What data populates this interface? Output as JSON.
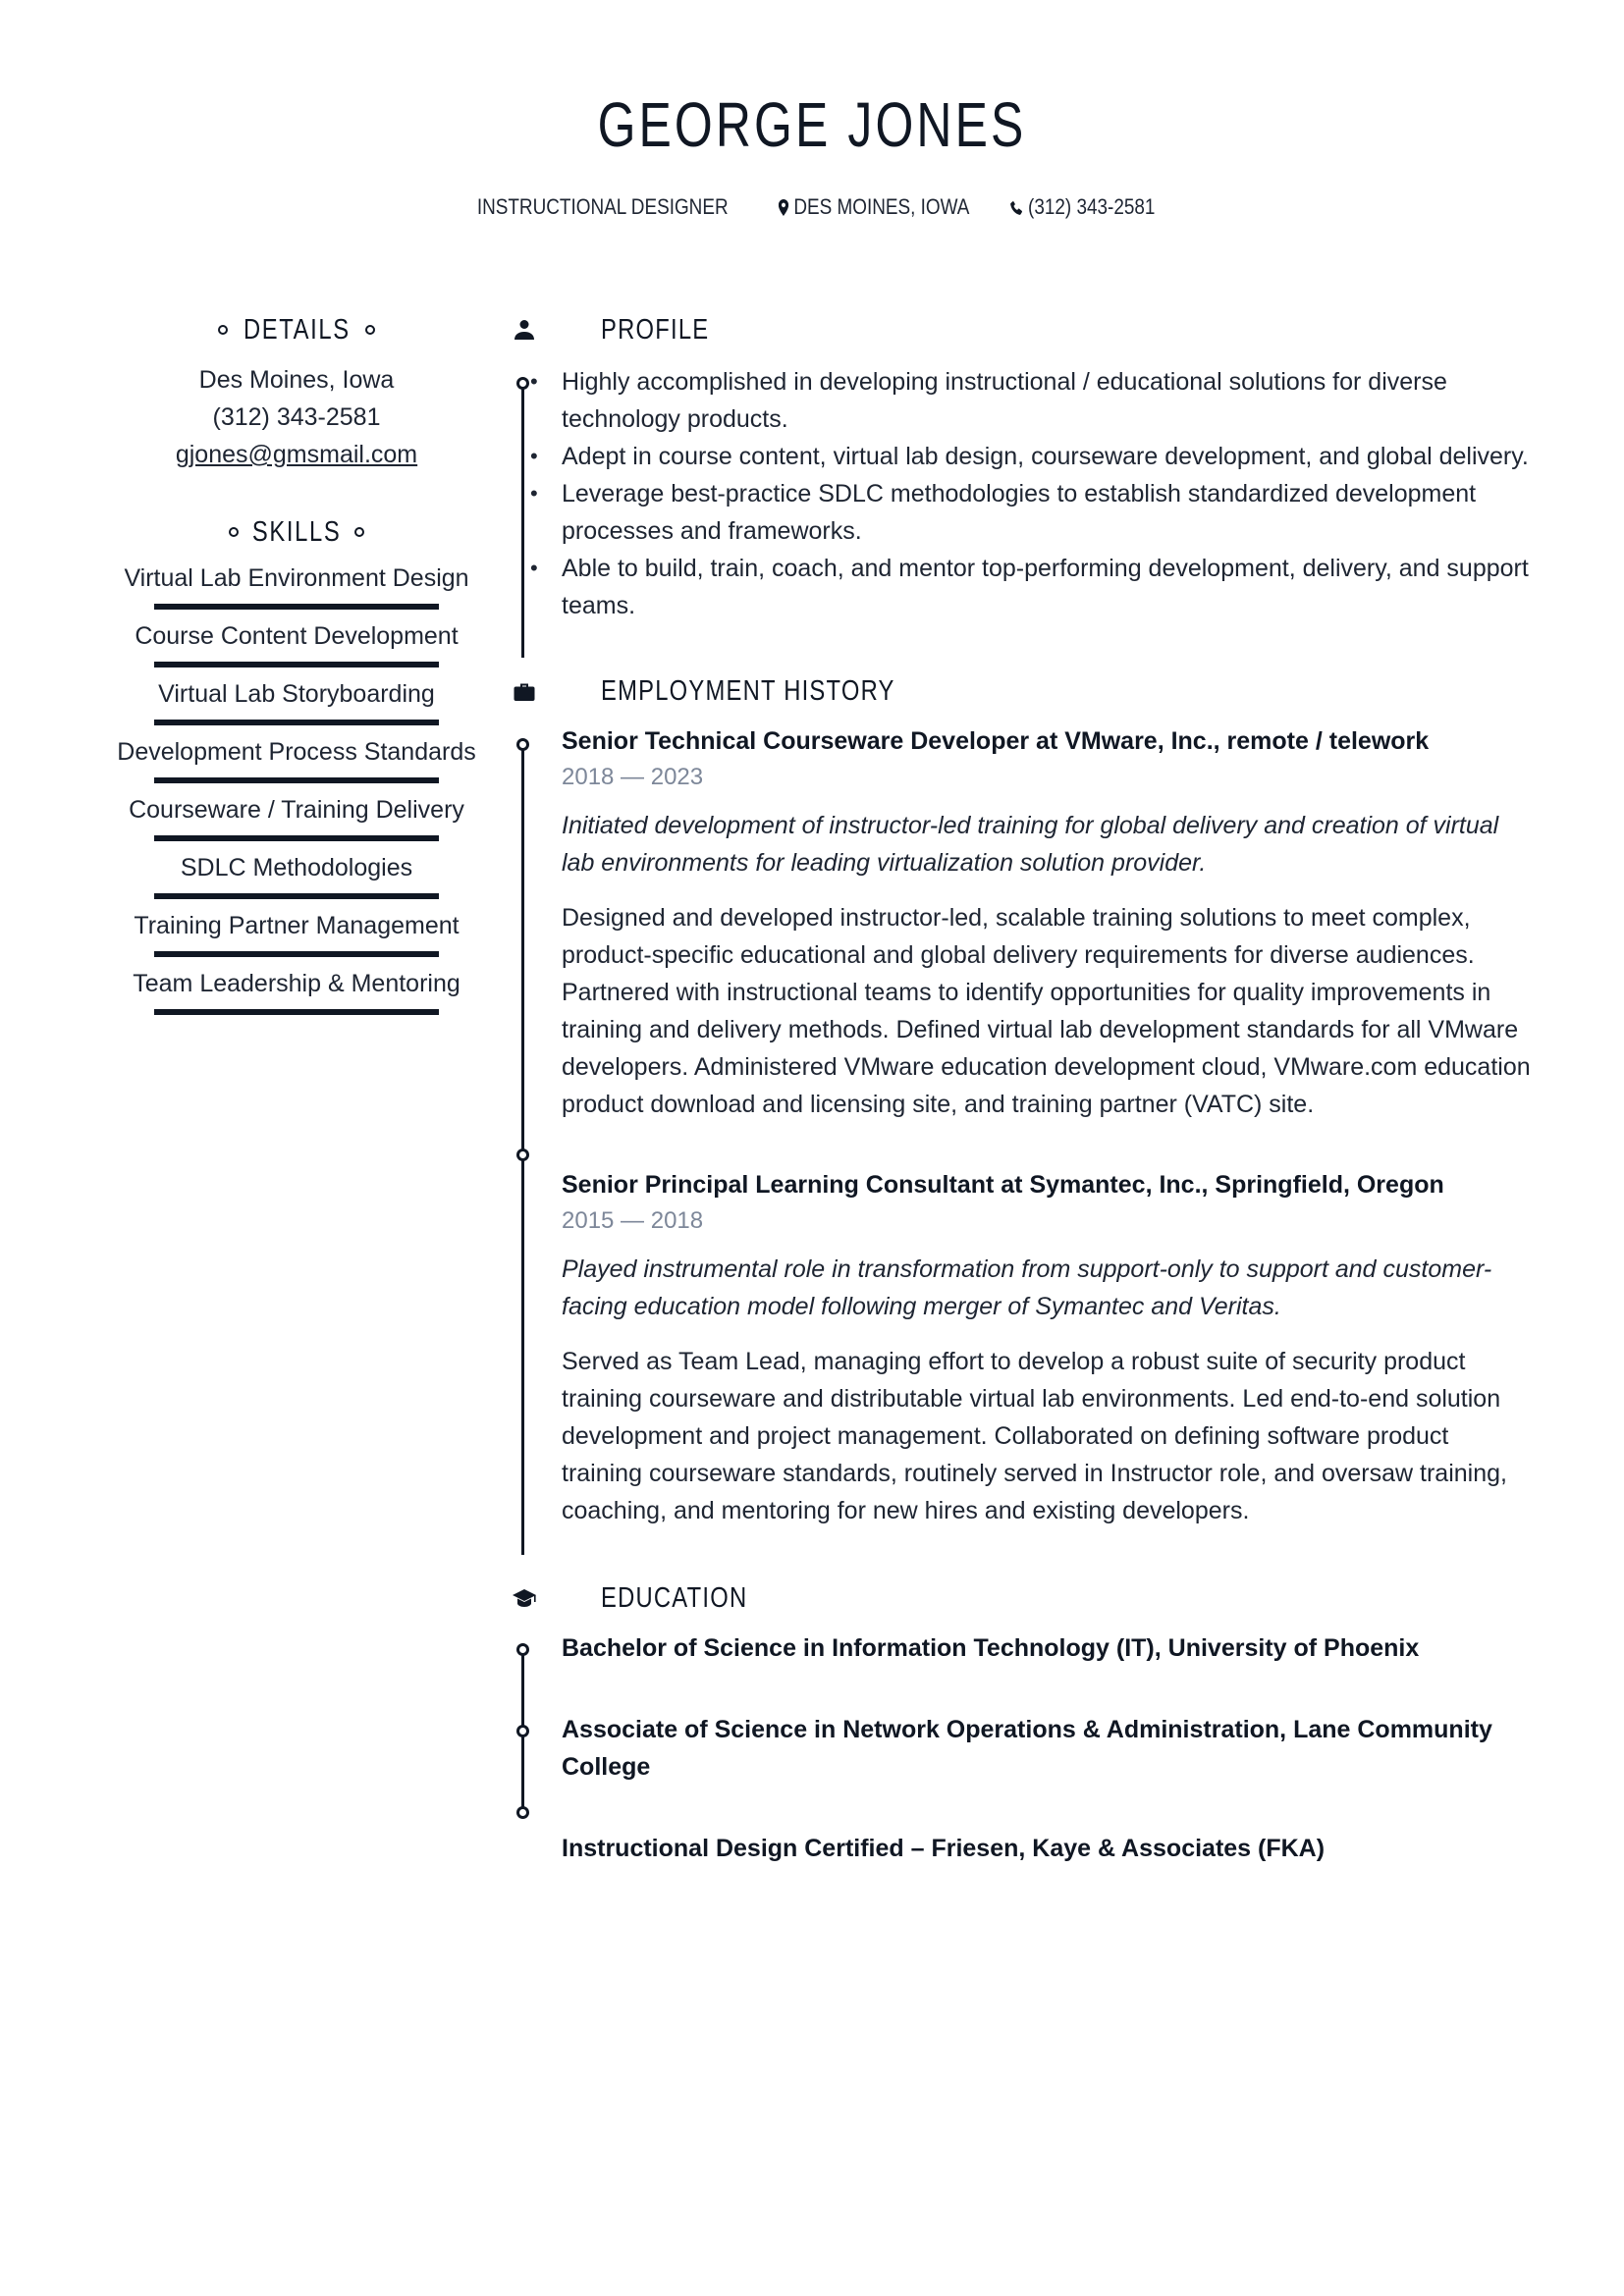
{
  "header": {
    "name": "GEORGE JONES",
    "job_title": "INSTRUCTIONAL DESIGNER",
    "location": "DES MOINES, IOWA",
    "phone": "(312) 343-2581",
    "location_icon": "map-pin-icon",
    "phone_icon": "phone-icon"
  },
  "details": {
    "heading": "DETAILS",
    "city": "Des Moines, Iowa",
    "phone": "(312) 343-2581",
    "email": "gjones@gmsmail.com"
  },
  "skills": {
    "heading": "SKILLS",
    "items": [
      {
        "label": "Virtual Lab Environment Design",
        "level": 1.0
      },
      {
        "label": "Course Content Development",
        "level": 1.0
      },
      {
        "label": "Virtual Lab Storyboarding",
        "level": 1.0
      },
      {
        "label": "Development Process Standards",
        "level": 1.0
      },
      {
        "label": "Courseware / Training Delivery",
        "level": 1.0
      },
      {
        "label": "SDLC Methodologies",
        "level": 1.0
      },
      {
        "label": "Training Partner Management",
        "level": 1.0
      },
      {
        "label": "Team Leadership & Mentoring",
        "level": 1.0
      }
    ]
  },
  "profile": {
    "heading": "PROFILE",
    "icon": "person-icon",
    "bullets": [
      "Highly accomplished in developing instructional / educational solutions for diverse technology products.",
      "Adept in course content, virtual lab design, courseware development, and global delivery.",
      "Leverage best-practice SDLC methodologies to establish standardized development processes and frameworks.",
      "Able to build, train, coach, and mentor top-performing development, delivery, and support teams."
    ]
  },
  "employment": {
    "heading": "EMPLOYMENT HISTORY",
    "icon": "briefcase-icon",
    "jobs": [
      {
        "title": "Senior Technical Courseware Developer at VMware, Inc., remote / telework",
        "dates": "2018 — 2023",
        "summary": "Initiated development of instructor-led training for global delivery and creation of virtual lab environments for leading virtualization solution provider.",
        "description": "Designed and developed instructor-led, scalable training solutions to meet complex, product-specific educational and global delivery requirements for diverse audiences. Partnered with instructional teams to identify opportunities for quality improvements in training and delivery methods. Defined virtual lab development standards for all VMware developers. Administered VMware education development cloud, VMware.com education product download and licensing site, and training partner (VATC) site."
      },
      {
        "title": "Senior Principal Learning Consultant  at Symantec, Inc., Springfield, Oregon",
        "dates": "2015 — 2018",
        "summary": "Played instrumental role in transformation from support-only to support and customer-facing education model following merger of Symantec and Veritas.",
        "description": "Served as Team Lead, managing effort to develop a robust suite of security product training courseware and distributable virtual lab environments. Led end-to-end solution development and project management. Collaborated on defining software product training courseware standards, routinely served in Instructor role, and oversaw training, coaching, and mentoring for new hires and existing developers."
      }
    ]
  },
  "education": {
    "heading": "EDUCATION",
    "icon": "graduation-cap-icon",
    "items": [
      "Bachelor of Science in Information Technology (IT), University of Phoenix",
      "Associate of Science in Network Operations & Administration, Lane Community College",
      "Instructional Design Certified – Friesen, Kaye & Associates (FKA)"
    ]
  },
  "colors": {
    "text_dark": "#101723",
    "text_body": "#1e2532",
    "date_gray": "#7d8799"
  }
}
